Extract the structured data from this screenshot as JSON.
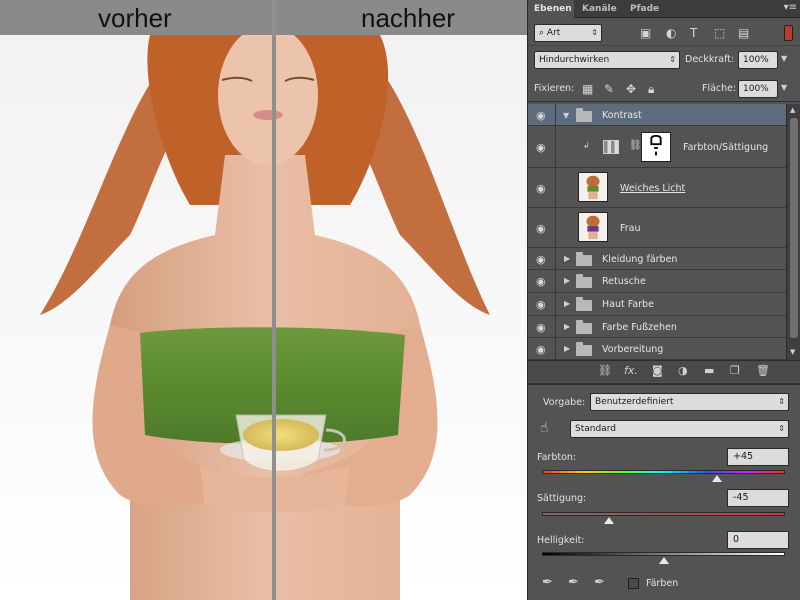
{
  "comparison": {
    "before_label": "vorher",
    "after_label": "nachher"
  },
  "layers_panel": {
    "tabs": [
      "Ebenen",
      "Kanäle",
      "Pfade"
    ],
    "filter": {
      "kind": "Art"
    },
    "blend_mode": "Hindurchwirken",
    "opacity_label": "Deckkraft:",
    "opacity_value": "100%",
    "lock_label": "Fixieren:",
    "fill_label": "Fläche:",
    "fill_value": "100%",
    "layers": [
      {
        "name": "Kontrast",
        "type": "group",
        "expanded": true,
        "selected": true
      },
      {
        "name": "Farbton/Sättigung",
        "type": "adjustment"
      },
      {
        "name": "Weiches Licht",
        "type": "image"
      },
      {
        "name": "Frau",
        "type": "image"
      },
      {
        "name": "Kleidung färben",
        "type": "group"
      },
      {
        "name": "Retusche",
        "type": "group"
      },
      {
        "name": "Haut Farbe",
        "type": "group"
      },
      {
        "name": "Farbe Fußzehen",
        "type": "group"
      },
      {
        "name": "Vorbereitung",
        "type": "group"
      }
    ]
  },
  "properties_panel": {
    "preset_label": "Vorgabe:",
    "preset_value": "Benutzerdefiniert",
    "channel_value": "Standard",
    "hue": {
      "label": "Farbton:",
      "value": "+45",
      "position": 0.72
    },
    "saturation": {
      "label": "Sättigung:",
      "value": "-45",
      "position": 0.275
    },
    "lightness": {
      "label": "Helligkeit:",
      "value": "0",
      "position": 0.5
    },
    "colorize_label": "Färben"
  },
  "colors": {
    "panel_bg": "#535353",
    "selected_row": "#5d6b7d",
    "top_color": "#5e8a35",
    "hair_color": "#b8561f"
  }
}
